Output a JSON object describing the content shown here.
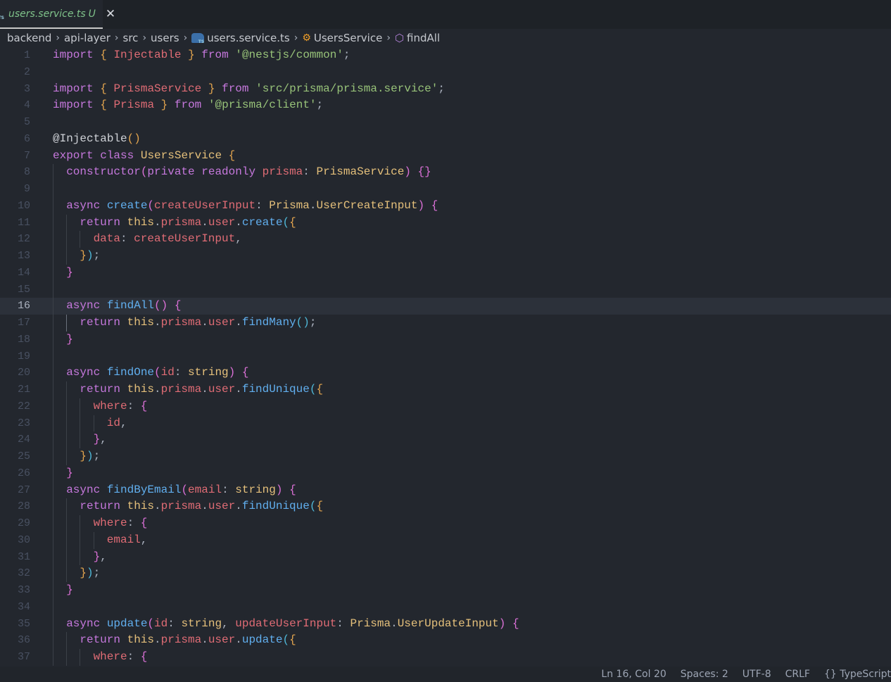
{
  "tab": {
    "filename": "users.service.ts",
    "status": "U",
    "close": "✕",
    "icon": "typescript-file-icon"
  },
  "breadcrumb": {
    "items": [
      "backend",
      "api-layer",
      "src",
      "users"
    ],
    "file": "users.service.ts",
    "class": "UsersService",
    "method": "findAll",
    "separator": "›"
  },
  "editor": {
    "active_line": 16,
    "lines": [
      {
        "n": 1,
        "i": 0,
        "t": [
          [
            "import",
            "k"
          ],
          [
            " ",
            "p"
          ],
          [
            "{",
            "b1"
          ],
          [
            " ",
            "p"
          ],
          [
            "Injectable",
            "v"
          ],
          [
            " ",
            "p"
          ],
          [
            "}",
            "b1"
          ],
          [
            " ",
            "p"
          ],
          [
            "from",
            "k"
          ],
          [
            " ",
            "p"
          ],
          [
            "'@nestjs/common'",
            "s"
          ],
          [
            ";",
            "p"
          ]
        ]
      },
      {
        "n": 2,
        "i": 0,
        "t": []
      },
      {
        "n": 3,
        "i": 0,
        "t": [
          [
            "import",
            "k"
          ],
          [
            " ",
            "p"
          ],
          [
            "{",
            "b1"
          ],
          [
            " ",
            "p"
          ],
          [
            "PrismaService",
            "v"
          ],
          [
            " ",
            "p"
          ],
          [
            "}",
            "b1"
          ],
          [
            " ",
            "p"
          ],
          [
            "from",
            "k"
          ],
          [
            " ",
            "p"
          ],
          [
            "'src/prisma/prisma.service'",
            "s"
          ],
          [
            ";",
            "p"
          ]
        ]
      },
      {
        "n": 4,
        "i": 0,
        "t": [
          [
            "import",
            "k"
          ],
          [
            " ",
            "p"
          ],
          [
            "{",
            "b1"
          ],
          [
            " ",
            "p"
          ],
          [
            "Prisma",
            "v"
          ],
          [
            " ",
            "p"
          ],
          [
            "}",
            "b1"
          ],
          [
            " ",
            "p"
          ],
          [
            "from",
            "k"
          ],
          [
            " ",
            "p"
          ],
          [
            "'@prisma/client'",
            "s"
          ],
          [
            ";",
            "p"
          ]
        ]
      },
      {
        "n": 5,
        "i": 0,
        "t": []
      },
      {
        "n": 6,
        "i": 0,
        "t": [
          [
            "@Injectable",
            "d"
          ],
          [
            "()",
            "b1"
          ]
        ]
      },
      {
        "n": 7,
        "i": 0,
        "t": [
          [
            "export",
            "k"
          ],
          [
            " ",
            "p"
          ],
          [
            "class",
            "k"
          ],
          [
            " ",
            "p"
          ],
          [
            "UsersService",
            "t"
          ],
          [
            " ",
            "p"
          ],
          [
            "{",
            "b1"
          ]
        ]
      },
      {
        "n": 8,
        "i": 1,
        "t": [
          [
            "constructor",
            "k"
          ],
          [
            "(",
            "b2"
          ],
          [
            "private",
            "k"
          ],
          [
            " ",
            "p"
          ],
          [
            "readonly",
            "k"
          ],
          [
            " ",
            "p"
          ],
          [
            "prisma",
            "v"
          ],
          [
            ": ",
            "p"
          ],
          [
            "PrismaService",
            "t"
          ],
          [
            ")",
            "b2"
          ],
          [
            " ",
            "p"
          ],
          [
            "{}",
            "b2"
          ]
        ]
      },
      {
        "n": 9,
        "i": 1,
        "t": []
      },
      {
        "n": 10,
        "i": 1,
        "t": [
          [
            "async",
            "k"
          ],
          [
            " ",
            "p"
          ],
          [
            "create",
            "f"
          ],
          [
            "(",
            "b2"
          ],
          [
            "createUserInput",
            "v"
          ],
          [
            ": ",
            "p"
          ],
          [
            "Prisma",
            "t"
          ],
          [
            ".",
            "p"
          ],
          [
            "UserCreateInput",
            "t"
          ],
          [
            ")",
            "b2"
          ],
          [
            " ",
            "p"
          ],
          [
            "{",
            "b2"
          ]
        ]
      },
      {
        "n": 11,
        "i": 2,
        "t": [
          [
            "return",
            "k"
          ],
          [
            " ",
            "p"
          ],
          [
            "this",
            "t"
          ],
          [
            ".",
            "p"
          ],
          [
            "prisma",
            "v"
          ],
          [
            ".",
            "p"
          ],
          [
            "user",
            "v"
          ],
          [
            ".",
            "p"
          ],
          [
            "create",
            "f"
          ],
          [
            "(",
            "b3"
          ],
          [
            "{",
            "b1"
          ]
        ]
      },
      {
        "n": 12,
        "i": 3,
        "t": [
          [
            "data",
            "v"
          ],
          [
            ": ",
            "p"
          ],
          [
            "createUserInput",
            "v"
          ],
          [
            ",",
            "p"
          ]
        ]
      },
      {
        "n": 13,
        "i": 2,
        "t": [
          [
            "}",
            "b1"
          ],
          [
            ")",
            "b3"
          ],
          [
            ";",
            "p"
          ]
        ]
      },
      {
        "n": 14,
        "i": 1,
        "t": [
          [
            "}",
            "b2"
          ]
        ]
      },
      {
        "n": 15,
        "i": 1,
        "t": []
      },
      {
        "n": 16,
        "i": 1,
        "t": [
          [
            "async",
            "k"
          ],
          [
            " ",
            "p"
          ],
          [
            "findAll",
            "f"
          ],
          [
            "()",
            "b2"
          ],
          [
            " ",
            "p"
          ],
          [
            "{",
            "b2"
          ]
        ]
      },
      {
        "n": 17,
        "i": 2,
        "t": [
          [
            "return",
            "k"
          ],
          [
            " ",
            "p"
          ],
          [
            "this",
            "t"
          ],
          [
            ".",
            "p"
          ],
          [
            "prisma",
            "v"
          ],
          [
            ".",
            "p"
          ],
          [
            "user",
            "v"
          ],
          [
            ".",
            "p"
          ],
          [
            "findMany",
            "f"
          ],
          [
            "()",
            "b3"
          ],
          [
            ";",
            "p"
          ]
        ]
      },
      {
        "n": 18,
        "i": 1,
        "t": [
          [
            "}",
            "b2"
          ]
        ]
      },
      {
        "n": 19,
        "i": 1,
        "t": []
      },
      {
        "n": 20,
        "i": 1,
        "t": [
          [
            "async",
            "k"
          ],
          [
            " ",
            "p"
          ],
          [
            "findOne",
            "f"
          ],
          [
            "(",
            "b2"
          ],
          [
            "id",
            "v"
          ],
          [
            ": ",
            "p"
          ],
          [
            "string",
            "t"
          ],
          [
            ")",
            "b2"
          ],
          [
            " ",
            "p"
          ],
          [
            "{",
            "b2"
          ]
        ]
      },
      {
        "n": 21,
        "i": 2,
        "t": [
          [
            "return",
            "k"
          ],
          [
            " ",
            "p"
          ],
          [
            "this",
            "t"
          ],
          [
            ".",
            "p"
          ],
          [
            "prisma",
            "v"
          ],
          [
            ".",
            "p"
          ],
          [
            "user",
            "v"
          ],
          [
            ".",
            "p"
          ],
          [
            "findUnique",
            "f"
          ],
          [
            "(",
            "b3"
          ],
          [
            "{",
            "b1"
          ]
        ]
      },
      {
        "n": 22,
        "i": 3,
        "t": [
          [
            "where",
            "v"
          ],
          [
            ": ",
            "p"
          ],
          [
            "{",
            "b2"
          ]
        ]
      },
      {
        "n": 23,
        "i": 4,
        "t": [
          [
            "id",
            "v"
          ],
          [
            ",",
            "p"
          ]
        ]
      },
      {
        "n": 24,
        "i": 3,
        "t": [
          [
            "}",
            "b2"
          ],
          [
            ",",
            "p"
          ]
        ]
      },
      {
        "n": 25,
        "i": 2,
        "t": [
          [
            "}",
            "b1"
          ],
          [
            ")",
            "b3"
          ],
          [
            ";",
            "p"
          ]
        ]
      },
      {
        "n": 26,
        "i": 1,
        "t": [
          [
            "}",
            "b2"
          ]
        ]
      },
      {
        "n": 27,
        "i": 1,
        "t": [
          [
            "async",
            "k"
          ],
          [
            " ",
            "p"
          ],
          [
            "findByEmail",
            "f"
          ],
          [
            "(",
            "b2"
          ],
          [
            "email",
            "v"
          ],
          [
            ": ",
            "p"
          ],
          [
            "string",
            "t"
          ],
          [
            ")",
            "b2"
          ],
          [
            " ",
            "p"
          ],
          [
            "{",
            "b2"
          ]
        ]
      },
      {
        "n": 28,
        "i": 2,
        "t": [
          [
            "return",
            "k"
          ],
          [
            " ",
            "p"
          ],
          [
            "this",
            "t"
          ],
          [
            ".",
            "p"
          ],
          [
            "prisma",
            "v"
          ],
          [
            ".",
            "p"
          ],
          [
            "user",
            "v"
          ],
          [
            ".",
            "p"
          ],
          [
            "findUnique",
            "f"
          ],
          [
            "(",
            "b3"
          ],
          [
            "{",
            "b1"
          ]
        ]
      },
      {
        "n": 29,
        "i": 3,
        "t": [
          [
            "where",
            "v"
          ],
          [
            ": ",
            "p"
          ],
          [
            "{",
            "b2"
          ]
        ]
      },
      {
        "n": 30,
        "i": 4,
        "t": [
          [
            "email",
            "v"
          ],
          [
            ",",
            "p"
          ]
        ]
      },
      {
        "n": 31,
        "i": 3,
        "t": [
          [
            "}",
            "b2"
          ],
          [
            ",",
            "p"
          ]
        ]
      },
      {
        "n": 32,
        "i": 2,
        "t": [
          [
            "}",
            "b1"
          ],
          [
            ")",
            "b3"
          ],
          [
            ";",
            "p"
          ]
        ]
      },
      {
        "n": 33,
        "i": 1,
        "t": [
          [
            "}",
            "b2"
          ]
        ]
      },
      {
        "n": 34,
        "i": 1,
        "t": []
      },
      {
        "n": 35,
        "i": 1,
        "t": [
          [
            "async",
            "k"
          ],
          [
            " ",
            "p"
          ],
          [
            "update",
            "f"
          ],
          [
            "(",
            "b2"
          ],
          [
            "id",
            "v"
          ],
          [
            ": ",
            "p"
          ],
          [
            "string",
            "t"
          ],
          [
            ", ",
            "p"
          ],
          [
            "updateUserInput",
            "v"
          ],
          [
            ": ",
            "p"
          ],
          [
            "Prisma",
            "t"
          ],
          [
            ".",
            "p"
          ],
          [
            "UserUpdateInput",
            "t"
          ],
          [
            ")",
            "b2"
          ],
          [
            " ",
            "p"
          ],
          [
            "{",
            "b2"
          ]
        ]
      },
      {
        "n": 36,
        "i": 2,
        "t": [
          [
            "return",
            "k"
          ],
          [
            " ",
            "p"
          ],
          [
            "this",
            "t"
          ],
          [
            ".",
            "p"
          ],
          [
            "prisma",
            "v"
          ],
          [
            ".",
            "p"
          ],
          [
            "user",
            "v"
          ],
          [
            ".",
            "p"
          ],
          [
            "update",
            "f"
          ],
          [
            "(",
            "b3"
          ],
          [
            "{",
            "b1"
          ]
        ]
      },
      {
        "n": 37,
        "i": 3,
        "t": [
          [
            "where",
            "v"
          ],
          [
            ": ",
            "p"
          ],
          [
            "{",
            "b2"
          ]
        ]
      }
    ]
  },
  "statusbar": {
    "position": "Ln 16, Col 20",
    "spaces": "Spaces: 2",
    "encoding": "UTF-8",
    "eol": "CRLF",
    "language": "{} TypeScript"
  },
  "colors": {
    "keyword": "#c678dd",
    "variable": "#e06c75",
    "function": "#61afef",
    "string": "#98c379",
    "type": "#e5c07b",
    "background": "#23272e"
  }
}
